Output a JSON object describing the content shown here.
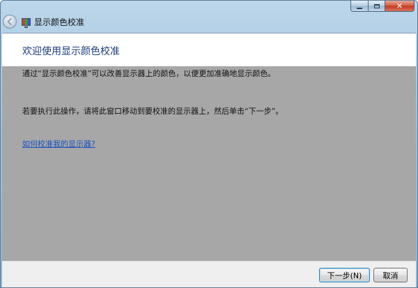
{
  "window": {
    "title": "显示颜色校准",
    "close_glyph": "✕"
  },
  "content": {
    "heading": "欢迎使用显示颜色校准",
    "paragraph_1": "通过“显示颜色校准”可以改善显示器上的颜色，以便更加准确地显示颜色。",
    "paragraph_2": "若要执行此操作，请将此窗口移动到要校准的显示器上，然后单击“下一步”。",
    "help_link": "如何校准我的显示器?"
  },
  "footer": {
    "next_label": "下一步(N)",
    "cancel_label": "取消"
  },
  "icons": {
    "back": "back-arrow-icon",
    "app": "display-calibration-icon",
    "minimize": "minimize-icon",
    "maximize": "maximize-icon",
    "close": "close-icon"
  },
  "colors": {
    "heading": "#1a3d7a",
    "link": "#1a50c0",
    "content_background": "#a7a7a7",
    "close_button": "#c8472c"
  }
}
